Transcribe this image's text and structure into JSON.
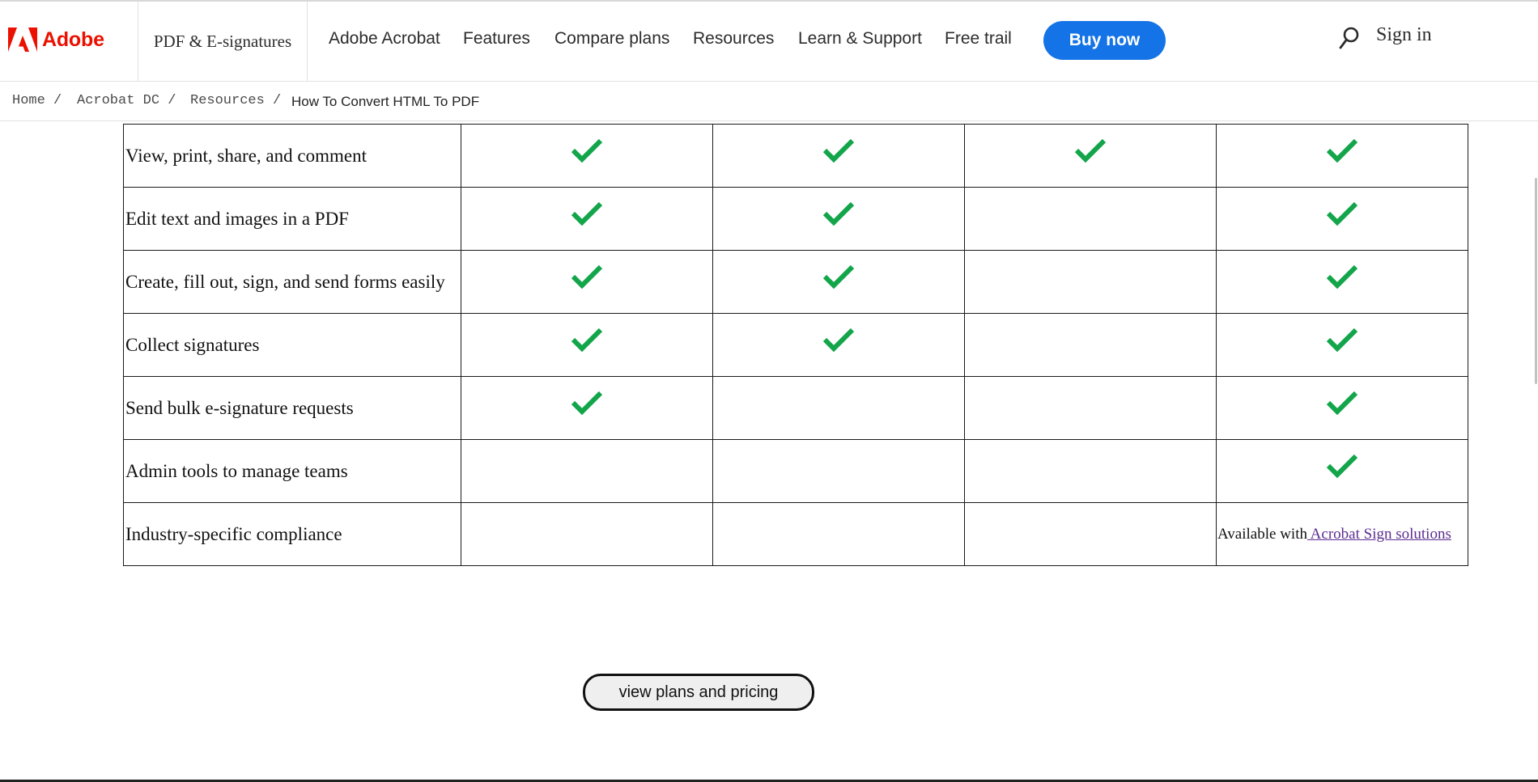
{
  "header": {
    "logo_text": "Adobe",
    "nav_box_label": "PDF & E-signatures",
    "nav": [
      "Adobe Acrobat",
      "Features",
      "Compare plans",
      "Resources",
      "Learn & Support",
      "Free trail"
    ],
    "buy_now": "Buy now",
    "sign_in": "Sign in",
    "search_icon": "search-icon"
  },
  "breadcrumb": {
    "items": [
      "Home /",
      "Acrobat DC /",
      "Resources /"
    ],
    "current": "How To Convert HTML To PDF"
  },
  "table": {
    "rows": [
      {
        "feature": "View, print, share, and comment",
        "checks": [
          true,
          true,
          true,
          true
        ]
      },
      {
        "feature": "Edit text and images in a PDF",
        "checks": [
          true,
          true,
          false,
          true
        ]
      },
      {
        "feature": "Create, fill out, sign, and send forms easily",
        "checks": [
          true,
          true,
          false,
          true
        ]
      },
      {
        "feature": "Collect signatures",
        "checks": [
          true,
          true,
          false,
          true
        ]
      },
      {
        "feature": "Send bulk e-signature requests",
        "checks": [
          true,
          false,
          false,
          true
        ]
      },
      {
        "feature": "Admin tools to manage teams",
        "checks": [
          false,
          false,
          false,
          true
        ]
      },
      {
        "feature": "Industry-specific compliance",
        "checks": [
          false,
          false,
          false,
          false
        ]
      }
    ],
    "compliance_note_prefix": "Available with",
    "compliance_link": " Acrobat Sign solutions",
    "check_color": "#12a54a"
  },
  "cta": {
    "plans_button": "view plans and pricing"
  },
  "colors": {
    "brand_red": "#eb1000",
    "buy_blue": "#1473e6",
    "link_purple": "#5b2d91"
  }
}
